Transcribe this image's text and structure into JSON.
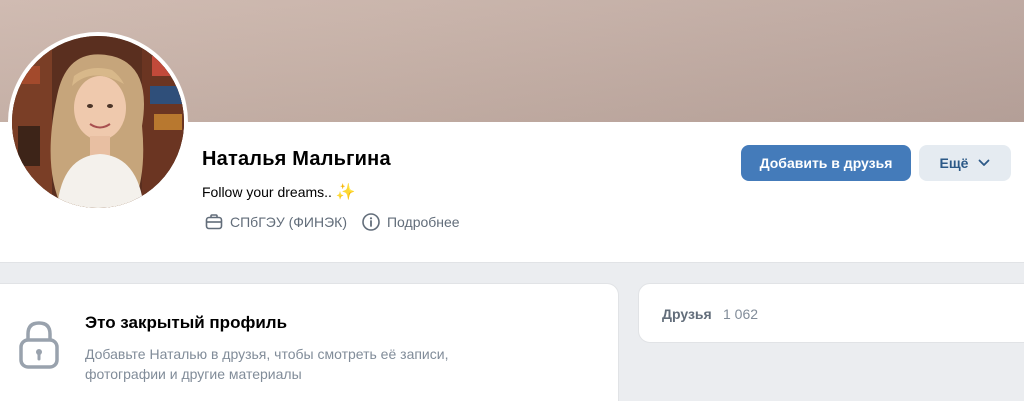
{
  "profile": {
    "name": "Наталья Мальгина",
    "status": "Follow your dreams..",
    "status_emoji": "✨",
    "education": "СПбГЭУ (ФИНЭК)",
    "details_link": "Подробнее"
  },
  "actions": {
    "add_friend": "Добавить в друзья",
    "more": "Ещё"
  },
  "private_notice": {
    "title": "Это закрытый профиль",
    "description_line1": "Добавьте Наталью в друзья, чтобы смотреть её записи,",
    "description_line2": "фотографии и другие материалы"
  },
  "friends": {
    "label": "Друзья",
    "count": "1 062"
  },
  "colors": {
    "primary_button": "#447bba",
    "secondary_button": "#e5ebf1",
    "page_background": "#ebedf0"
  },
  "icons": [
    "briefcase-icon",
    "info-icon",
    "chevron-down-icon",
    "lock-icon"
  ]
}
